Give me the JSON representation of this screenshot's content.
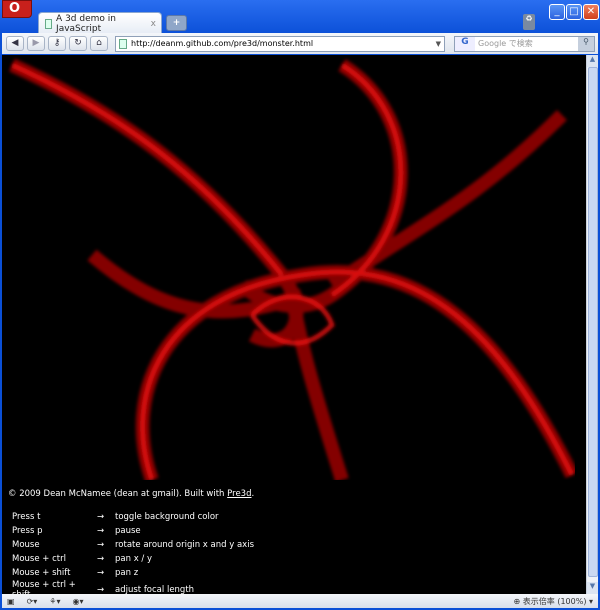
{
  "browser": {
    "logo": "O",
    "tab_title": "A 3d demo in JavaScript",
    "tab_close": "x",
    "new_tab": "+",
    "url": "http://deanm.github.com/pre3d/monster.html",
    "search_placeholder": "Google で検索",
    "zoom_label": "表示倍率 (100%)"
  },
  "page": {
    "credits_prefix": "© 2009 Dean McNamee (dean at gmail). Built with ",
    "credits_link": "Pre3d",
    "credits_suffix": ".",
    "arrow": "→",
    "controls": [
      {
        "input": "Press t",
        "action": "toggle background color"
      },
      {
        "input": "Press p",
        "action": "pause"
      },
      {
        "input": "Mouse",
        "action": "rotate around origin x and y axis"
      },
      {
        "input": "Mouse + ctrl",
        "action": "pan x / y"
      },
      {
        "input": "Mouse + shift",
        "action": "pan z"
      },
      {
        "input": "Mouse + ctrl + shift",
        "action": "adjust focal length"
      }
    ]
  }
}
